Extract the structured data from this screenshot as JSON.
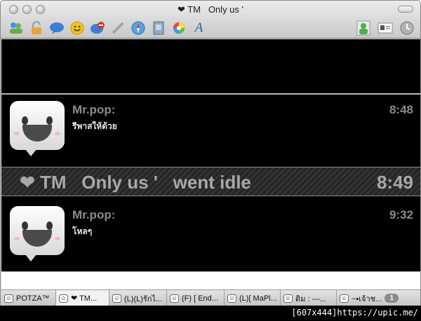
{
  "window": {
    "title": "❤ TM   Only us '"
  },
  "toolbar": {
    "icons": [
      "contacts-icon",
      "lock-icon",
      "bubble-icon",
      "smiley-icon",
      "block-icon",
      "link-icon",
      "safari-icon",
      "file-icon",
      "color-icon",
      "font-icon"
    ],
    "right_icons": [
      "person-icon",
      "card-icon",
      "history-icon"
    ],
    "font_glyph": "A"
  },
  "messages": [
    {
      "sender": "Mr.pop:",
      "text": "รีพาสให้ด้วย",
      "time": "8:48"
    },
    {
      "sender": "Mr.pop:",
      "text": "โหลๆ",
      "time": "9:32"
    }
  ],
  "status": {
    "text": "❤ TM   Only us '   went idle",
    "time": "8:49"
  },
  "input": {
    "value": ""
  },
  "tabs": [
    {
      "label": "POTZA™",
      "active": false
    },
    {
      "label": "❤ TM...",
      "active": true
    },
    {
      "label": "(L)(L)รักไ...",
      "active": false
    },
    {
      "label": "(F) [ End...",
      "active": false
    },
    {
      "label": "(L)[ MaPl...",
      "active": false
    },
    {
      "label": "ดิม : ---...",
      "active": false
    },
    {
      "label": "~•เจ้าช...",
      "active": false,
      "badge": "1"
    }
  ],
  "watermark": "[607x444]https://upic.me/"
}
